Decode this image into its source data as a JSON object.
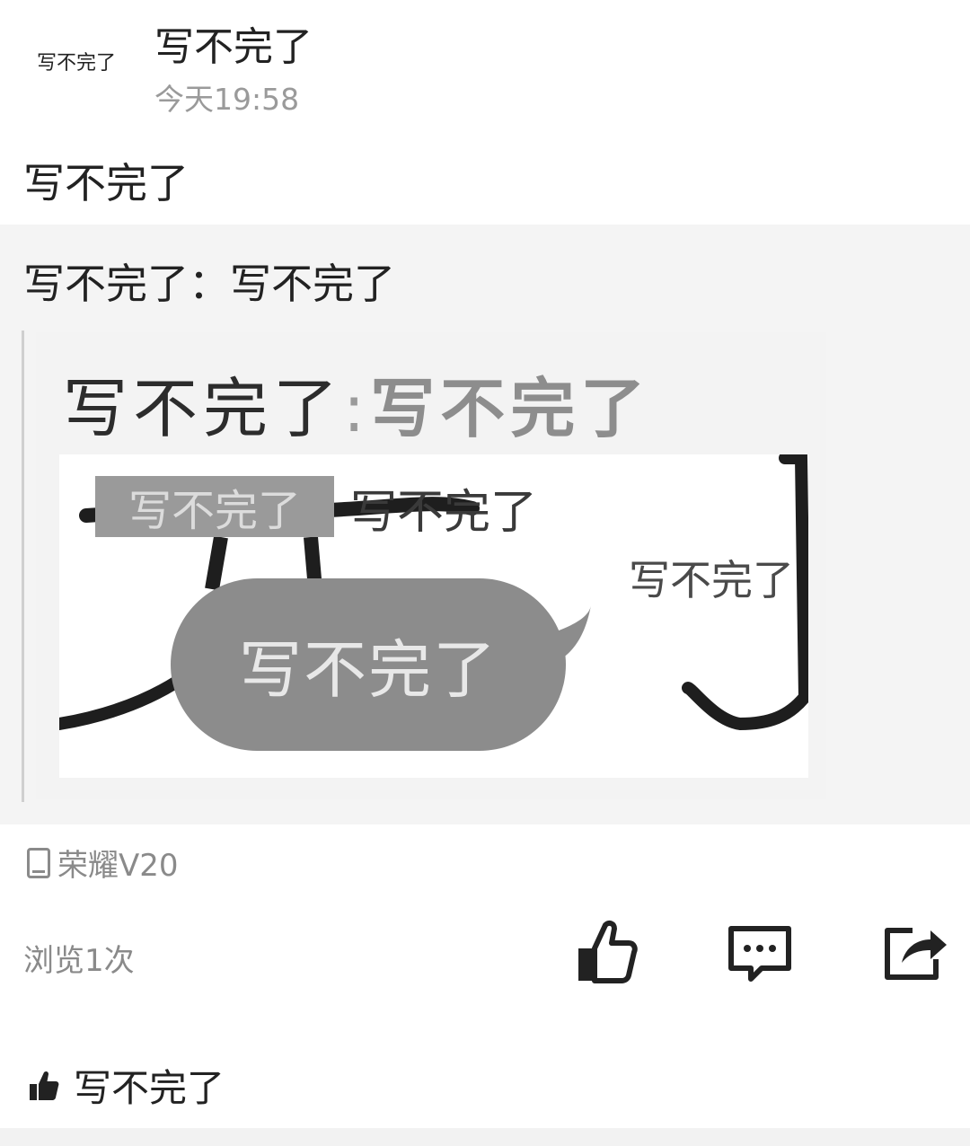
{
  "post": {
    "avatar_text": "写不完了",
    "username": "写不完了",
    "time": "今天19:58",
    "text": "写不完了"
  },
  "quote": {
    "text": "写不完了：写不完了",
    "meme": {
      "head_who": "写不完了",
      "head_sep": ":",
      "head_what": "写不完了",
      "label_box": "写不完了",
      "label_plain": "写不完了",
      "label_right": "写不完了",
      "bubble": "写不完了"
    }
  },
  "meta": {
    "device_icon": "phone-icon",
    "device": "荣耀V20",
    "views": "浏览1次"
  },
  "actions": {
    "like_icon": "thumbs-up-icon",
    "comment_icon": "comment-icon",
    "share_icon": "share-icon"
  },
  "likes": {
    "icon": "thumbs-up-filled-icon",
    "names": "写不完了"
  }
}
